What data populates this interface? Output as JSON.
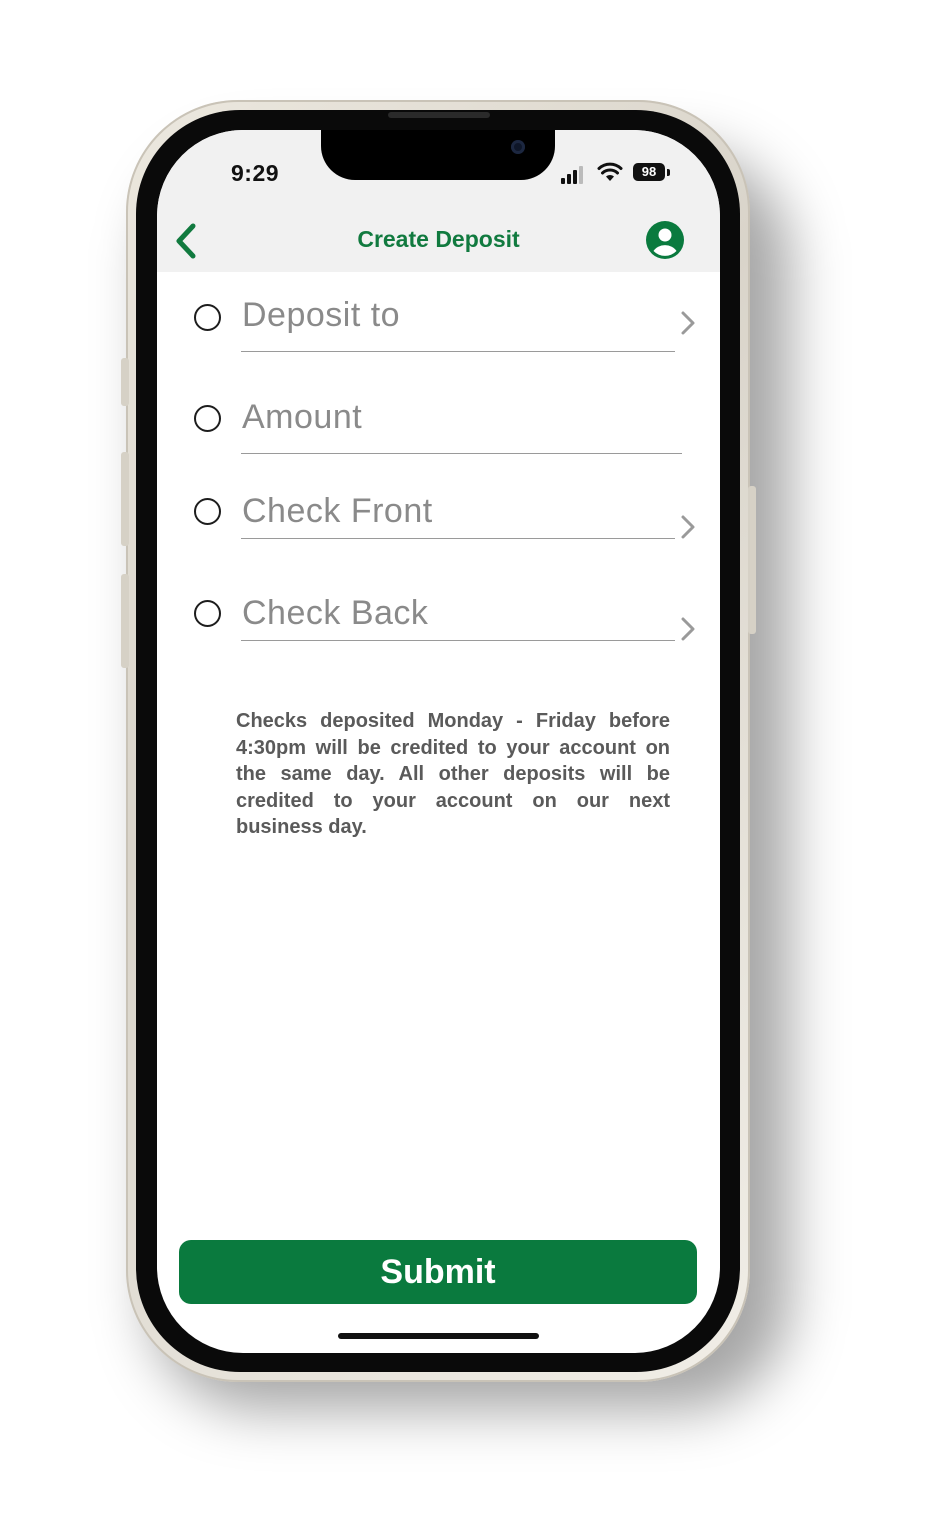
{
  "status_bar": {
    "time": "9:29",
    "battery": "98"
  },
  "nav": {
    "title": "Create Deposit"
  },
  "form": {
    "rows": [
      {
        "label": "Deposit to",
        "has_chevron": true
      },
      {
        "label": "Amount",
        "has_chevron": false
      },
      {
        "label": "Check Front",
        "has_chevron": true
      },
      {
        "label": "Check Back",
        "has_chevron": true
      }
    ]
  },
  "info_text": "Checks deposited Monday - Friday before 4:30pm will be credited to your account on the same day. All other deposits will be credited to your account on our next business day.",
  "submit_label": "Submit",
  "colors": {
    "brand_green": "#0a7a3e",
    "title_green": "#117a3f",
    "header_bg": "#f1f1f1",
    "placeholder_gray": "#8a8a8a"
  },
  "icons": {
    "back": "chevron-left-icon",
    "profile": "user-circle-icon",
    "row_chevron": "chevron-right-icon",
    "radio": "radio-unchecked-icon"
  }
}
